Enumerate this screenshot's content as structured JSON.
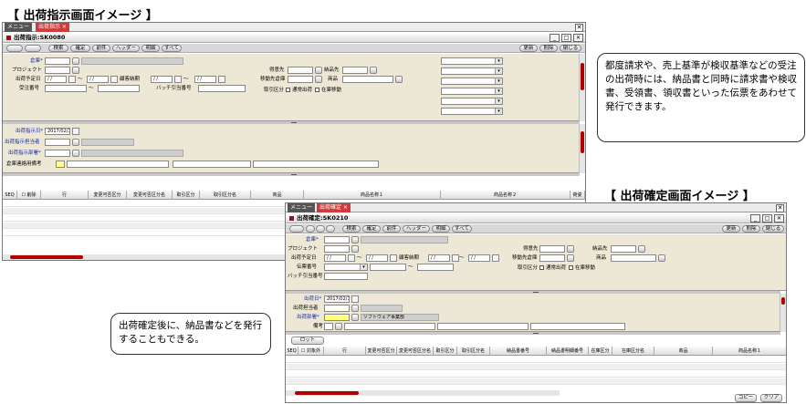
{
  "heading_shukka_shiji": "【 出荷指示画面イメージ 】",
  "heading_shukka_kakutei": "【 出荷確定画面イメージ 】",
  "callout_right": "都度請求や、売上基準が検収基準などの受注の出荷時には、納品書と同時に請求書や検収書、受領書、領収書といった伝票をあわせて発行できます。",
  "callout_left": "出荷確定後に、納品書などを発行することもできる。",
  "win1": {
    "tab_menu": "メニュー",
    "tab_active": "出荷指示 ✕",
    "title": "出荷指示:SK0080",
    "toolbar_left": [
      "",
      "",
      "検索",
      "確定",
      "前件",
      "ヘッダー",
      "明細",
      "すべて"
    ],
    "toolbar_right": [
      "更新",
      "削除",
      "閉じる"
    ],
    "labels": {
      "warehouse": "倉庫*",
      "project": "プロジェクト",
      "ship_date": "出荷予定日",
      "order_no": "受注番号",
      "delivery_date": "顧客納期",
      "batch_no": "バッチ引当番号",
      "billing_to": "得意先",
      "deliver_to": "納品先",
      "dest_warehouse": "移動先倉庫",
      "product": "商品",
      "pull_type": "取引区分",
      "chk1": "通常出荷",
      "chk2": "在庫移動",
      "instruct_date": "出荷指示日*",
      "instructor": "出荷指示担当者",
      "instruct_dept": "出荷指示部署*",
      "contact_no": "倉庫連絡用備考"
    },
    "date_value": "2017/02/13",
    "date_slash": "/ /",
    "tilde": "〜",
    "grid_headers": [
      "SEQ",
      "☐ 削除",
      "行",
      "変更可否区分",
      "変更可否区分名",
      "取引区分",
      "取引区分名",
      "商品",
      "商品名称１",
      "商品名称２",
      "荷姿"
    ]
  },
  "win2": {
    "tab_menu": "メニュー",
    "tab_active": "出荷確定 ✕",
    "title": "出荷確定:SK0210",
    "toolbar_left": [
      "",
      "",
      "",
      "",
      "検索",
      "確定",
      "前件",
      "ヘッダー",
      "明細",
      "すべて"
    ],
    "toolbar_right": [
      "更新",
      "削除",
      "閉じる"
    ],
    "labels": {
      "warehouse": "倉庫*",
      "project": "プロジェクト",
      "ship_date": "出荷予定日",
      "slip_no": "伝票番号",
      "batch_no": "バッチ引当番号",
      "delivery_date": "顧客納期",
      "billing_to": "得意先",
      "deliver_to": "納品先",
      "dest_warehouse": "移動先倉庫",
      "product": "商品",
      "pull_type": "取引区分",
      "chk1": "通常出荷",
      "chk2": "在庫移動",
      "ship_day": "出荷日*",
      "shipper": "出荷担当者",
      "ship_dept": "出荷部署*",
      "note": "備考"
    },
    "date_value": "2017/02/13",
    "dept_name": "ソフトウェア事業部",
    "date_slash": "/ /",
    "tilde": "〜",
    "lot_button": "ロット",
    "grid_headers": [
      "SEQ",
      "☐ 対象外",
      "行",
      "変更可否区分",
      "変更可否区分名",
      "取引区分",
      "取引区分名",
      "納品書番号",
      "納品書明細番号",
      "在庫区分",
      "在庫区分名",
      "商品",
      "商品名称１"
    ],
    "footer_buttons": [
      "コピー",
      "クリア"
    ]
  }
}
